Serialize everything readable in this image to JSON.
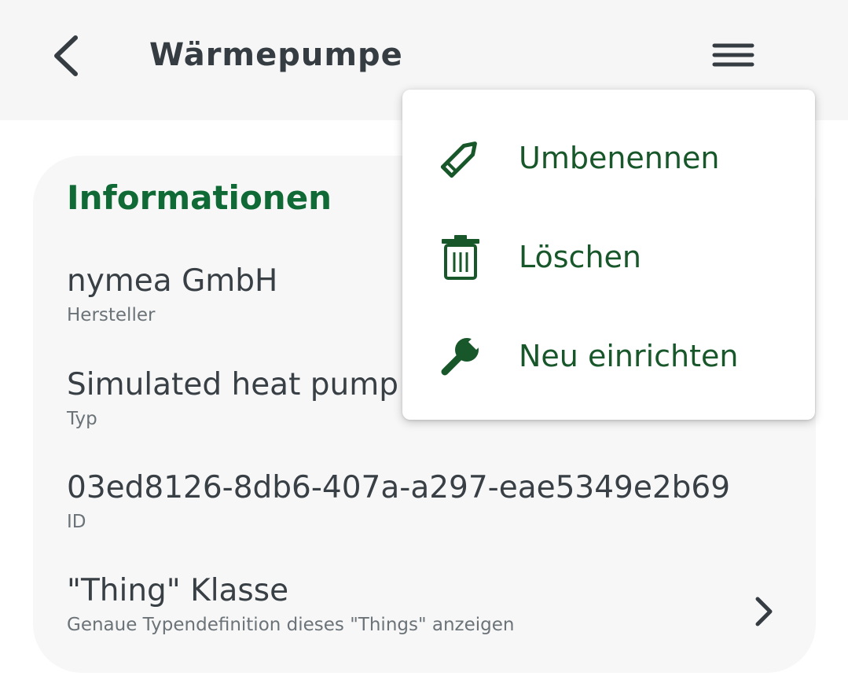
{
  "header": {
    "title": "Wärmepumpe",
    "back_icon": "chevron-left-icon",
    "menu_icon": "hamburger-menu-icon"
  },
  "card": {
    "heading": "Informationen",
    "rows": [
      {
        "value": "nymea GmbH",
        "label": "Hersteller"
      },
      {
        "value": "Simulated heat pump",
        "label": "Typ"
      },
      {
        "value": "03ed8126-8db6-407a-a297-eae5349e2b69",
        "label": "ID"
      },
      {
        "value": "\"Thing\" Klasse",
        "label": "Genaue Typendefinition dieses \"Things\" anzeigen",
        "icon": "chevron-right-icon"
      }
    ]
  },
  "menu": {
    "items": [
      {
        "label": "Umbenennen",
        "icon": "pencil-icon"
      },
      {
        "label": "Löschen",
        "icon": "trash-icon"
      },
      {
        "label": "Neu einrichten",
        "icon": "wrench-icon"
      }
    ]
  },
  "colors": {
    "header_bg": "#f6f6f6",
    "card_bg": "#f7f7f7",
    "accent_green": "#106a35",
    "menu_text": "#17572a",
    "primary_text": "#383f45",
    "secondary_text": "#6b7378"
  }
}
